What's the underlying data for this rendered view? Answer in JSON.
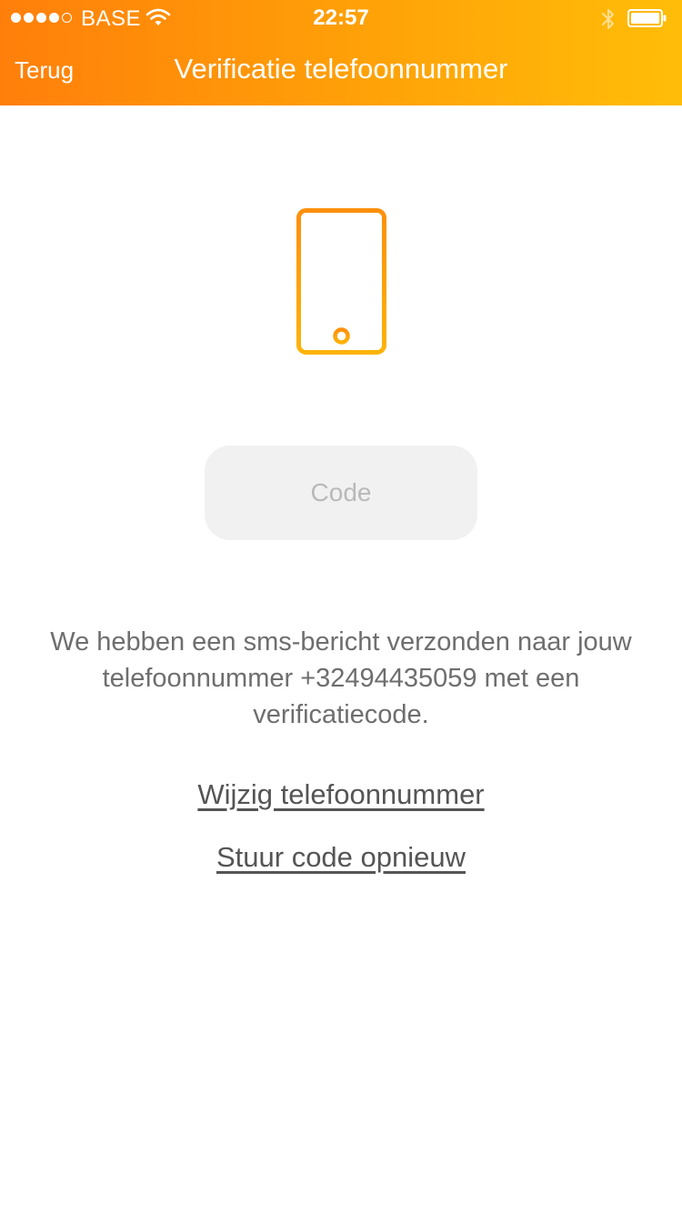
{
  "status_bar": {
    "carrier": "BASE",
    "time": "22:57",
    "signal_bars_filled": 4,
    "signal_bars_total": 5,
    "icons": [
      "wifi-icon",
      "bluetooth-icon",
      "battery-icon"
    ]
  },
  "nav": {
    "back_label": "Terug",
    "title": "Verificatie telefoonnummer"
  },
  "illustration": {
    "icon": "smartphone-icon",
    "color": "#ffa208"
  },
  "code_input": {
    "value": "",
    "placeholder": "Code"
  },
  "info": {
    "text": "We hebben een sms-bericht verzonden naar jouw telefoonnummer +32494435059 met een verificatiecode."
  },
  "links": {
    "change_number": "Wijzig telefoonnummer",
    "resend_code": "Stuur code opnieuw"
  },
  "colors": {
    "header_gradient_start": "#ff7f0a",
    "header_gradient_end": "#ffbd08",
    "accent": "#ffa208",
    "input_background": "#f1f1f1",
    "body_text": "#6e6e6e"
  }
}
